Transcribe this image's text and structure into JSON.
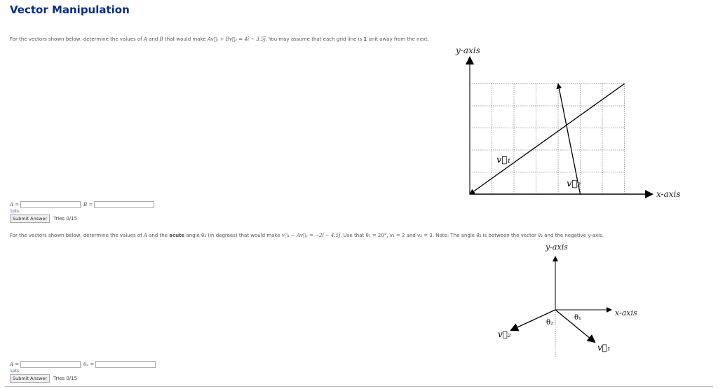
{
  "page": {
    "title": "Vector Manipulation"
  },
  "problem1": {
    "text_before": "For the vectors shown below, determine the values of ",
    "var_a": "A",
    "text_and": " and ",
    "var_b": "B",
    "text_mid": " that would make ",
    "equation": "Av⃗₁ + Bv⃗₂ = 4î − 3.5ĵ",
    "text_after": ". You may assume that each grid line is ",
    "bold_unit": "1",
    "text_end": " unit away from the next.",
    "inputs": [
      {
        "label": "A =",
        "value": "",
        "placeholder": ""
      },
      {
        "label": "B =",
        "value": "",
        "placeholder": ""
      }
    ],
    "points": "1pts",
    "submit_label": "Submit Answer",
    "tries": "Tries 0/15",
    "diagram": {
      "y_axis_label": "y-axis",
      "x_axis_label": "x-axis",
      "v1_label": "v⃗₁",
      "v2_label": "v⃗₂",
      "grid_cols": 7,
      "grid_rows": 5,
      "v1": {
        "tail": [
          7,
          5
        ],
        "head": [
          0,
          0
        ]
      },
      "v2": {
        "tail": [
          5,
          0
        ],
        "head": [
          4,
          5
        ]
      }
    }
  },
  "problem2": {
    "text_before": "For the vectors shown below, determine the values of ",
    "var_a": "A",
    "text_and": " and the ",
    "bold_word": "acute",
    "text_mid": " angle θ₂ (in degrees) that would make ",
    "equation": "v⃗₁ − Av⃗₂ = −2î − 4.5ĵ",
    "text_after": ". Use that θ₁ = 20°, v₁ = 2 and v₂ = 3. Note: The angle θ₂ is between the vector v⃗₂ and the negative y-axis.",
    "inputs": [
      {
        "label": "A =",
        "value": "",
        "placeholder": ""
      },
      {
        "label": "θ₂ =",
        "value": "",
        "placeholder": ""
      }
    ],
    "points": "1pts",
    "submit_label": "Submit Answer",
    "tries": "Tries 0/15",
    "diagram": {
      "y_axis_label": "y-axis",
      "x_axis_label": "x-axis",
      "v1_label": "v⃗₁",
      "v2_label": "v⃗₂",
      "theta1_label": "θ₁",
      "theta2_label": "θ₂"
    }
  }
}
